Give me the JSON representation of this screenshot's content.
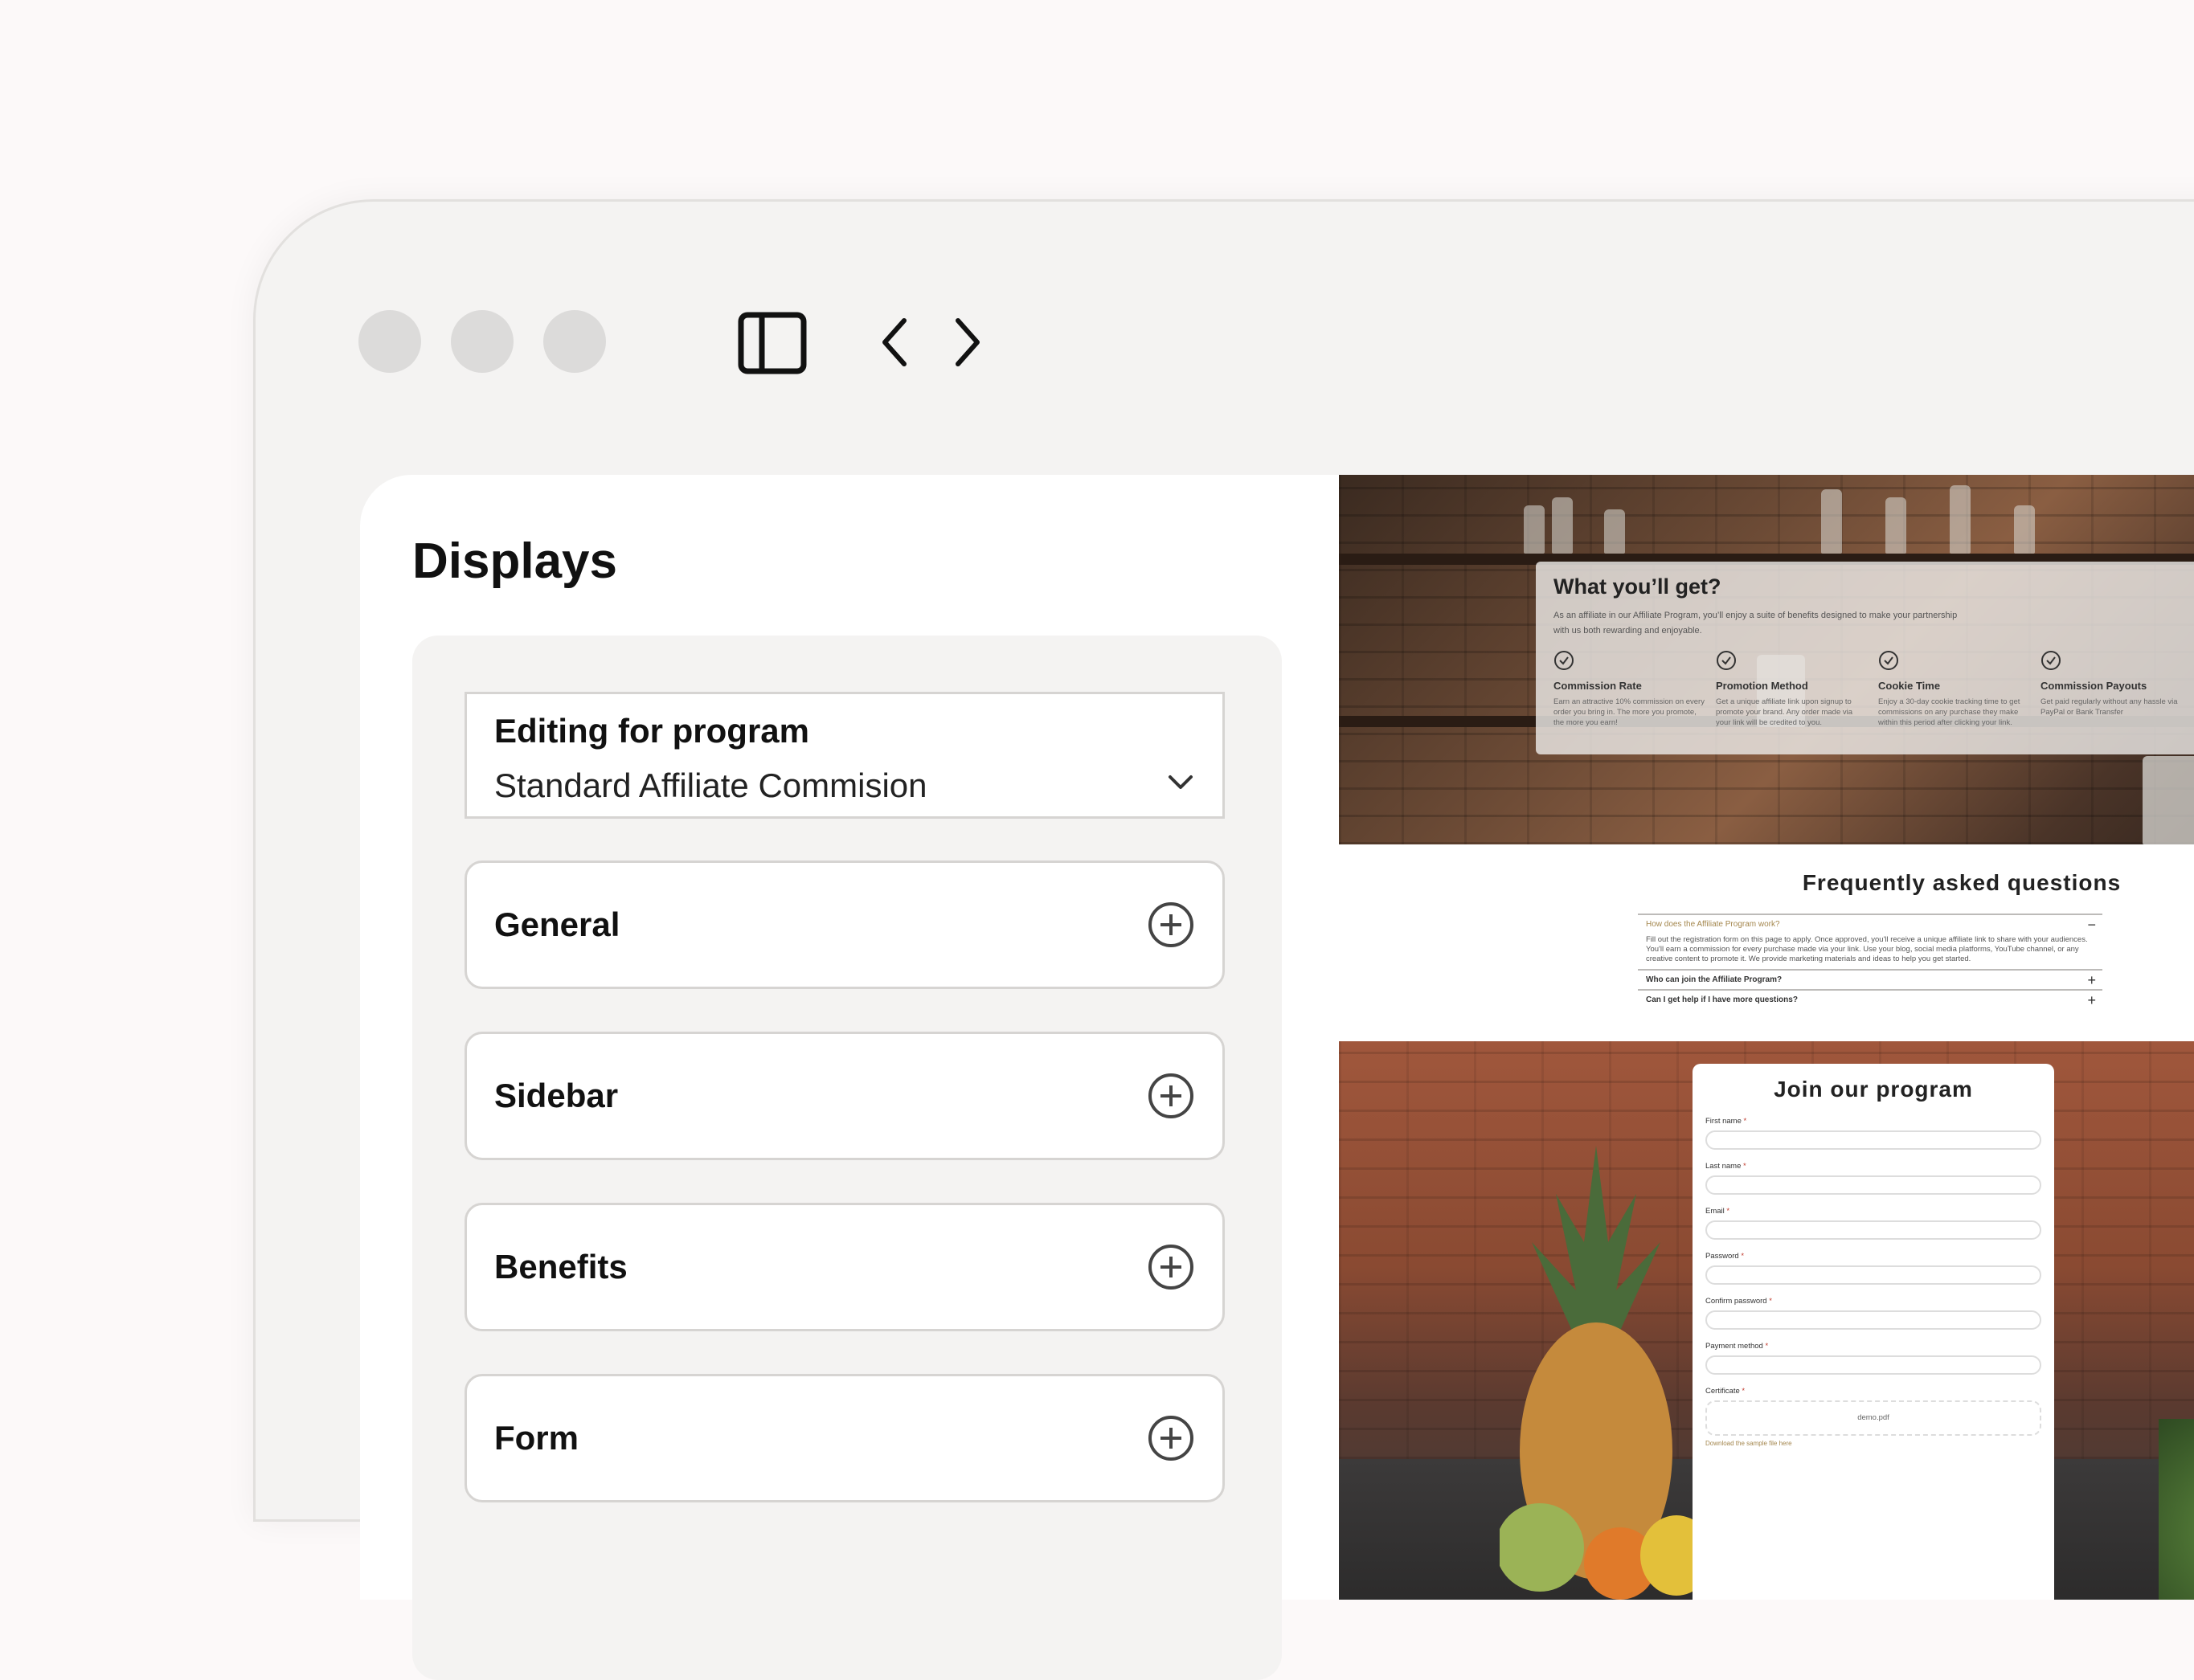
{
  "toolbar": {
    "window_dots": [
      "dot-1",
      "dot-2",
      "dot-3"
    ],
    "sidebar_toggle_icon": "sidebar-toggle-icon",
    "back_icon": "chevron-left-icon",
    "forward_icon": "chevron-right-icon"
  },
  "panel": {
    "title": "Displays",
    "program_field": {
      "label": "Editing for program",
      "value": "Standard Affiliate Commision"
    },
    "sections": [
      {
        "label": "General"
      },
      {
        "label": "Sidebar"
      },
      {
        "label": "Benefits"
      },
      {
        "label": "Form"
      }
    ]
  },
  "preview": {
    "benefits": {
      "title": "What you’ll get?",
      "description": "As an affiliate in our Affiliate Program, you’ll enjoy a suite of benefits designed to make your partnership with us both rewarding and enjoyable.",
      "items": [
        {
          "name": "Commission Rate",
          "text": "Earn an attractive 10% commission on every order you bring in. The more you promote, the more you earn!"
        },
        {
          "name": "Promotion Method",
          "text": "Get a unique affiliate link upon signup to promote your brand. Any order made via your link will be credited to you."
        },
        {
          "name": "Cookie Time",
          "text": "Enjoy a 30-day cookie tracking time to get commissions on any purchase they make within this period after clicking your link."
        },
        {
          "name": "Commission Payouts",
          "text": "Get paid regularly without any hassle via PayPal or Bank Transfer"
        }
      ]
    },
    "faq": {
      "title": "Frequently asked questions",
      "items": [
        {
          "q": "How does the Affiliate Program work?",
          "a": "Fill out the registration form on this page to apply. Once approved, you'll receive a unique affiliate link to share with your audiences. You'll earn a commission for every purchase made via your link. Use your blog, social media platforms, YouTube channel, or any creative content to promote it. We provide marketing materials and ideas to help you get started.",
          "sym": "−"
        },
        {
          "q": "Who can join the Affiliate Program?",
          "a": "",
          "sym": "+"
        },
        {
          "q": "Can I get help if I have more questions?",
          "a": "",
          "sym": "+"
        }
      ]
    },
    "form": {
      "title": "Join our program",
      "fields": [
        {
          "label": "First name",
          "req": "*"
        },
        {
          "label": "Last name",
          "req": "*"
        },
        {
          "label": "Email",
          "req": "*"
        },
        {
          "label": "Password",
          "req": "*"
        },
        {
          "label": "Confirm password",
          "req": "*"
        },
        {
          "label": "Payment method",
          "req": "*"
        }
      ],
      "certificate": {
        "label": "Certificate",
        "req": "*",
        "file": "demo.pdf",
        "hint": "Download the sample file here"
      }
    }
  }
}
